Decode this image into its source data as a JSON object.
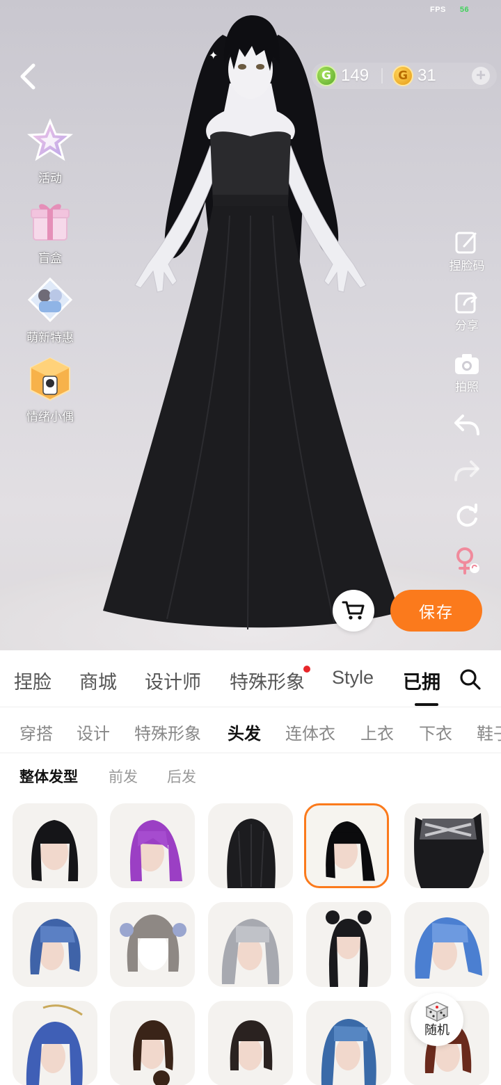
{
  "status": {
    "fps_label": "FPS",
    "fps_value": "56"
  },
  "currency": {
    "green_coin": "149",
    "gold_coin": "31"
  },
  "left_menu": [
    {
      "label": "活动",
      "icon": "star-event-icon"
    },
    {
      "label": "盲盒",
      "icon": "gift-box-icon"
    },
    {
      "label": "萌新特惠",
      "icon": "newbie-pack-icon"
    },
    {
      "label": "情绪小偶",
      "icon": "doll-box-icon"
    }
  ],
  "right_tools": [
    {
      "label": "捏脸码",
      "icon": "face-code-icon"
    },
    {
      "label": "分享",
      "icon": "share-icon"
    },
    {
      "label": "拍照",
      "icon": "camera-icon"
    },
    {
      "label": "",
      "icon": "undo-icon"
    },
    {
      "label": "",
      "icon": "redo-icon"
    },
    {
      "label": "",
      "icon": "reset-icon"
    },
    {
      "label": "",
      "icon": "gender-switch-icon"
    }
  ],
  "actions": {
    "save": "保存"
  },
  "main_tabs": [
    "捏脸",
    "商城",
    "设计师",
    "特殊形象",
    "Style",
    "已拥"
  ],
  "main_tab_active": "已拥",
  "sub_tabs": [
    "穿搭",
    "设计",
    "特殊形象",
    "头发",
    "连体衣",
    "上衣",
    "下衣",
    "鞋子"
  ],
  "sub_tab_active": "头发",
  "hair_categories": [
    "整体发型",
    "前发",
    "后发"
  ],
  "hair_category_active": "整体发型",
  "random": {
    "label": "随机"
  },
  "colors": {
    "accent": "#fb7a1c",
    "badge": "#e8262a",
    "fps_value": "#3fd35a"
  }
}
